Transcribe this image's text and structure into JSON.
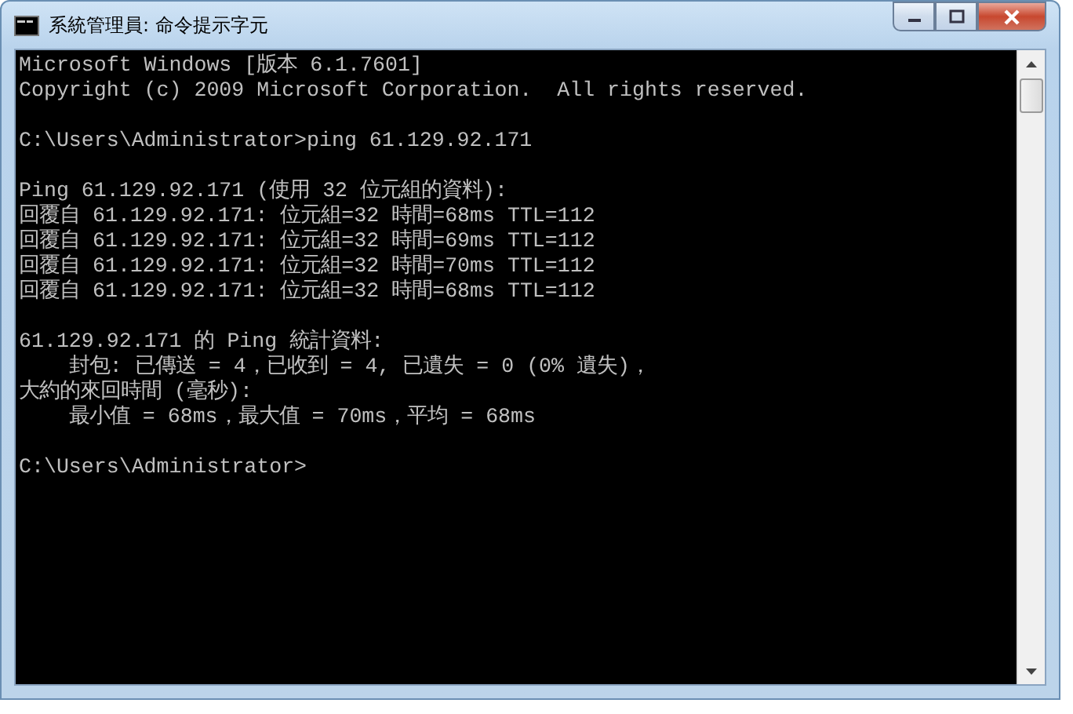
{
  "window": {
    "title": "系統管理員: 命令提示字元"
  },
  "console": {
    "blocks": [
      [
        "Microsoft Windows [版本 6.1.7601]",
        "Copyright (c) 2009 Microsoft Corporation.  All rights reserved."
      ],
      [
        "C:\\Users\\Administrator>ping 61.129.92.171"
      ],
      [
        "Ping 61.129.92.171 (使用 32 位元組的資料):",
        "回覆自 61.129.92.171: 位元組=32 時間=68ms TTL=112",
        "回覆自 61.129.92.171: 位元組=32 時間=69ms TTL=112",
        "回覆自 61.129.92.171: 位元組=32 時間=70ms TTL=112",
        "回覆自 61.129.92.171: 位元組=32 時間=68ms TTL=112"
      ],
      [
        "61.129.92.171 的 Ping 統計資料:",
        "    封包: 已傳送 = 4，已收到 = 4, 已遺失 = 0 (0% 遺失)，",
        "大約的來回時間 (毫秒):",
        "    最小值 = 68ms，最大值 = 70ms，平均 = 68ms"
      ],
      [
        "C:\\Users\\Administrator>"
      ]
    ]
  }
}
